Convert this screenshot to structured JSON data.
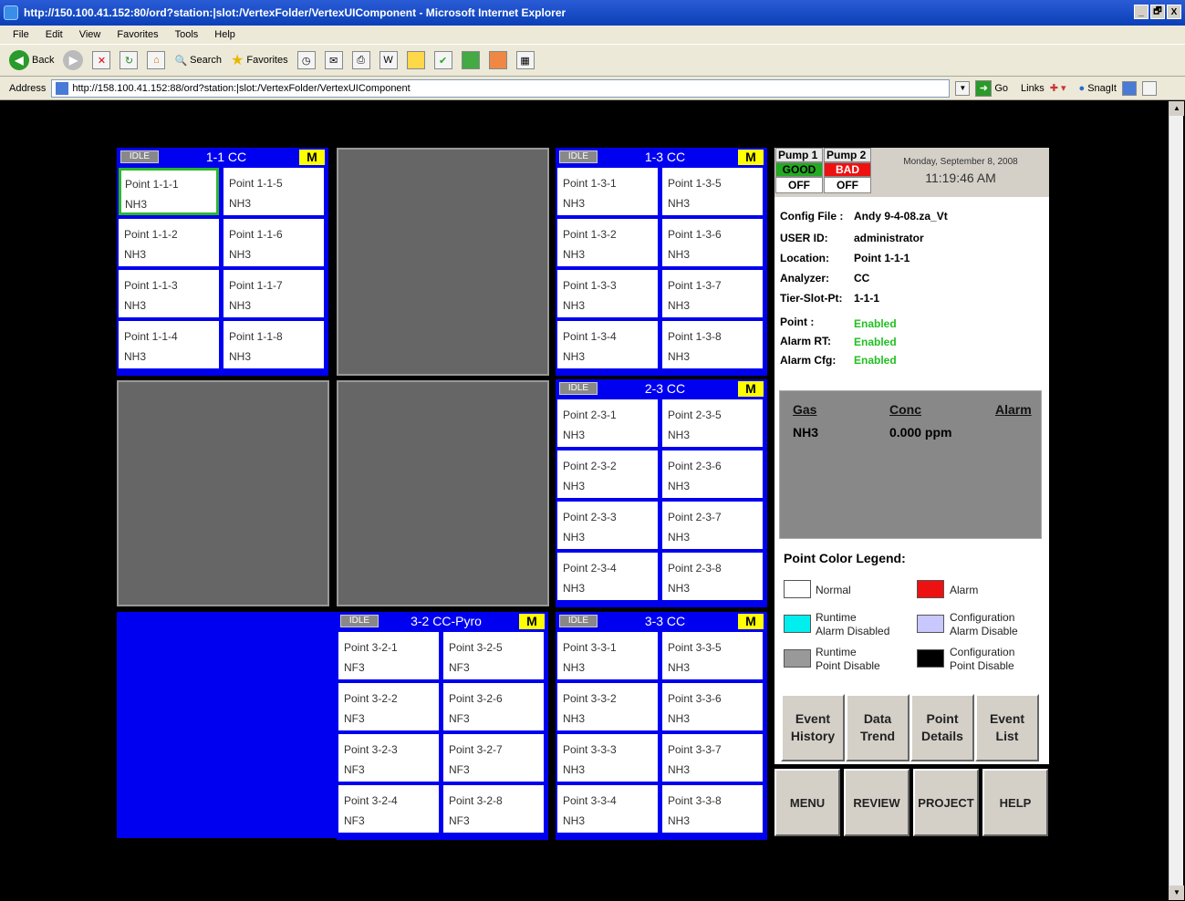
{
  "window": {
    "title": "http://150.100.41.152:80/ord?station:|slot:/VertexFolder/VertexUIComponent - Microsoft Internet Explorer",
    "buttons": [
      "_",
      "🗗",
      "X"
    ]
  },
  "menu": [
    "File",
    "Edit",
    "View",
    "Favorites",
    "Tools",
    "Help"
  ],
  "toolbar": {
    "back": "Back",
    "search": "Search",
    "favorites": "Favorites"
  },
  "address": {
    "label": "Address",
    "url": "http://158.100.41.152:88/ord?station:|slot:/VertexFolder/VertexUIComponent",
    "go": "Go",
    "links": "Links",
    "snagit": "SnagIt"
  },
  "panels": {
    "p11": {
      "idle": "IDLE",
      "title": "1-1  CC",
      "m": "M",
      "cells": [
        {
          "name": "Point 1-1-1",
          "gas": "NH3"
        },
        {
          "name": "Point 1-1-5",
          "gas": "NH3"
        },
        {
          "name": "Point 1-1-2",
          "gas": "NH3"
        },
        {
          "name": "Point 1-1-6",
          "gas": "NH3"
        },
        {
          "name": "Point 1-1-3",
          "gas": "NH3"
        },
        {
          "name": "Point 1-1-7",
          "gas": "NH3"
        },
        {
          "name": "Point 1-1-4",
          "gas": "NH3"
        },
        {
          "name": "Point 1-1-8",
          "gas": "NH3"
        }
      ]
    },
    "p13": {
      "idle": "IDLE",
      "title": "1-3  CC",
      "m": "M",
      "cells": [
        {
          "name": "Point 1-3-1",
          "gas": "NH3"
        },
        {
          "name": "Point 1-3-5",
          "gas": "NH3"
        },
        {
          "name": "Point 1-3-2",
          "gas": "NH3"
        },
        {
          "name": "Point 1-3-6",
          "gas": "NH3"
        },
        {
          "name": "Point 1-3-3",
          "gas": "NH3"
        },
        {
          "name": "Point 1-3-7",
          "gas": "NH3"
        },
        {
          "name": "Point 1-3-4",
          "gas": "NH3"
        },
        {
          "name": "Point 1-3-8",
          "gas": "NH3"
        }
      ]
    },
    "p23": {
      "idle": "IDLE",
      "title": "2-3  CC",
      "m": "M",
      "cells": [
        {
          "name": "Point 2-3-1",
          "gas": "NH3"
        },
        {
          "name": "Point 2-3-5",
          "gas": "NH3"
        },
        {
          "name": "Point 2-3-2",
          "gas": "NH3"
        },
        {
          "name": "Point 2-3-6",
          "gas": "NH3"
        },
        {
          "name": "Point 2-3-3",
          "gas": "NH3"
        },
        {
          "name": "Point 2-3-7",
          "gas": "NH3"
        },
        {
          "name": "Point 2-3-4",
          "gas": "NH3"
        },
        {
          "name": "Point 2-3-8",
          "gas": "NH3"
        }
      ]
    },
    "p32": {
      "idle": "IDLE",
      "title": "3-2  CC-Pyro",
      "m": "M",
      "cells": [
        {
          "name": "Point 3-2-1",
          "gas": "NF3"
        },
        {
          "name": "Point 3-2-5",
          "gas": "NF3"
        },
        {
          "name": "Point 3-2-2",
          "gas": "NF3"
        },
        {
          "name": "Point 3-2-6",
          "gas": "NF3"
        },
        {
          "name": "Point 3-2-3",
          "gas": "NF3"
        },
        {
          "name": "Point 3-2-7",
          "gas": "NF3"
        },
        {
          "name": "Point 3-2-4",
          "gas": "NF3"
        },
        {
          "name": "Point 3-2-8",
          "gas": "NF3"
        }
      ]
    },
    "p33": {
      "idle": "IDLE",
      "title": "3-3  CC",
      "m": "M",
      "cells": [
        {
          "name": "Point 3-3-1",
          "gas": "NH3"
        },
        {
          "name": "Point 3-3-5",
          "gas": "NH3"
        },
        {
          "name": "Point 3-3-2",
          "gas": "NH3"
        },
        {
          "name": "Point 3-3-6",
          "gas": "NH3"
        },
        {
          "name": "Point 3-3-3",
          "gas": "NH3"
        },
        {
          "name": "Point 3-3-7",
          "gas": "NH3"
        },
        {
          "name": "Point 3-3-4",
          "gas": "NH3"
        },
        {
          "name": "Point 3-3-8",
          "gas": "NH3"
        }
      ]
    }
  },
  "pumps": [
    {
      "label": "Pump 1",
      "status": "GOOD",
      "status_color": "#22aa22",
      "state": "OFF"
    },
    {
      "label": "Pump 2",
      "status": "BAD",
      "status_color": "#ee1111",
      "state": "OFF"
    }
  ],
  "datetime": {
    "date": "Monday, September 8, 2008",
    "time": "11:19:46 AM"
  },
  "info": {
    "config_label": "Config File :",
    "config_value": "Andy 9-4-08.za_Vt",
    "user_label": "USER ID:",
    "user_value": "administrator",
    "location_label": "Location:",
    "location_value": "Point 1-1-1",
    "analyzer_label": "Analyzer:",
    "analyzer_value": "CC",
    "tsp_label": "Tier-Slot-Pt:",
    "tsp_value": "1-1-1",
    "point_label": "Point :",
    "point_value": "Enabled",
    "alarmrt_label": "Alarm RT:",
    "alarmrt_value": "Enabled",
    "alarmcfg_label": "Alarm Cfg:",
    "alarmcfg_value": "Enabled"
  },
  "gas_table": {
    "h_gas": "Gas",
    "h_conc": "Conc",
    "h_alarm": "Alarm",
    "gas": "NH3",
    "conc": "0.000 ppm"
  },
  "legend": {
    "title": "Point Color Legend:",
    "items": [
      {
        "label": "Normal",
        "color": "#ffffff"
      },
      {
        "label": "Alarm",
        "color": "#ee1111"
      },
      {
        "label": "Runtime Alarm Disabled",
        "line1": "Runtime",
        "line2": "Alarm Disabled",
        "color": "#00eeee"
      },
      {
        "label": "Configuration Alarm Disable",
        "line1": "Configuration",
        "line2": "Alarm Disable",
        "color": "#c8c8ff"
      },
      {
        "label": "Runtime Point Disable",
        "line1": "Runtime",
        "line2": "Point Disable",
        "color": "#999999"
      },
      {
        "label": "Configuration Point Disable",
        "line1": "Configuration",
        "line2": "Point Disable",
        "color": "#000000"
      }
    ]
  },
  "action_buttons": [
    {
      "line1": "Event",
      "line2": "History"
    },
    {
      "line1": "Data",
      "line2": "Trend"
    },
    {
      "line1": "Point",
      "line2": "Details"
    },
    {
      "line1": "Event",
      "line2": "List"
    }
  ],
  "nav_buttons": [
    "MENU",
    "REVIEW",
    "PROJECT",
    "HELP"
  ]
}
